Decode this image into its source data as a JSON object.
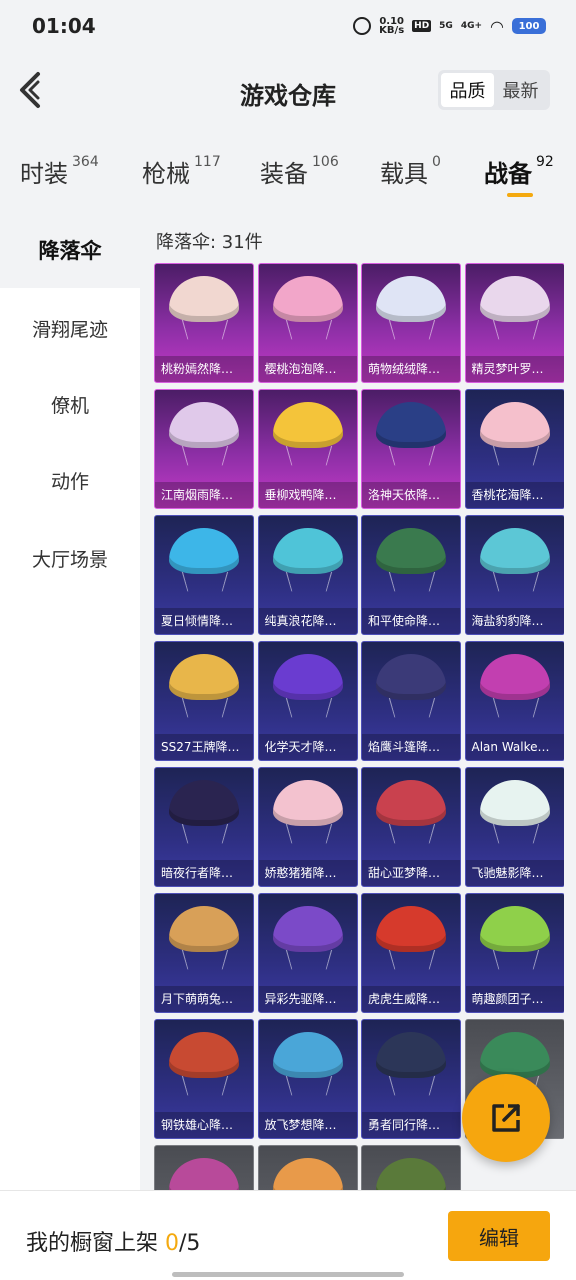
{
  "status_bar": {
    "time": "01:04",
    "speed_value": "0.10",
    "speed_unit": "KB/s",
    "hd1": "HD",
    "sig1": "5G",
    "sig2": "4G+",
    "battery": "100"
  },
  "header": {
    "title": "游戏仓库",
    "sort_options": [
      "品质",
      "最新"
    ],
    "sort_active": "品质"
  },
  "tabs": [
    {
      "label": "时装",
      "count": "364"
    },
    {
      "label": "枪械",
      "count": "117"
    },
    {
      "label": "装备",
      "count": "106"
    },
    {
      "label": "载具",
      "count": "0"
    },
    {
      "label": "战备",
      "count": "92"
    }
  ],
  "active_tab": "战备",
  "sidebar": {
    "items": [
      "降落伞",
      "滑翔尾迹",
      "僚机",
      "动作",
      "大厅场景"
    ],
    "active": "降落伞"
  },
  "grid": {
    "count_label": "降落伞: 31件",
    "items": [
      {
        "name": "桃粉嫣然降…",
        "rarity": "purple",
        "color": "#f1d7d0"
      },
      {
        "name": "樱桃泡泡降…",
        "rarity": "purple",
        "color": "#f2a6c9"
      },
      {
        "name": "萌物绒绒降…",
        "rarity": "purple",
        "color": "#dfe4f5"
      },
      {
        "name": "精灵梦叶罗…",
        "rarity": "purple",
        "color": "#e9d7ec"
      },
      {
        "name": "江南烟雨降…",
        "rarity": "purple",
        "color": "#e0c9ea"
      },
      {
        "name": "垂柳戏鸭降…",
        "rarity": "purple",
        "color": "#f4c43a"
      },
      {
        "name": "洛神天依降…",
        "rarity": "purple",
        "color": "#2a3f86"
      },
      {
        "name": "香桃花海降…",
        "rarity": "blue",
        "color": "#f5c0cc"
      },
      {
        "name": "夏日倾情降…",
        "rarity": "blue",
        "color": "#3db6e8"
      },
      {
        "name": "纯真浪花降…",
        "rarity": "blue",
        "color": "#4fc4d8"
      },
      {
        "name": "和平使命降…",
        "rarity": "blue",
        "color": "#3a7a4e"
      },
      {
        "name": "海盐豹豹降…",
        "rarity": "blue",
        "color": "#5cc7d6"
      },
      {
        "name": "SS27王牌降…",
        "rarity": "blue",
        "color": "#e8b64a"
      },
      {
        "name": "化学天才降…",
        "rarity": "blue",
        "color": "#6a3cd0"
      },
      {
        "name": "焰鹰斗篷降…",
        "rarity": "blue",
        "color": "#3b3a78"
      },
      {
        "name": "Alan Walke…",
        "rarity": "blue",
        "color": "#c23fb0"
      },
      {
        "name": "暗夜行者降…",
        "rarity": "blue",
        "color": "#2a2450"
      },
      {
        "name": "娇憨猪猪降…",
        "rarity": "blue",
        "color": "#f3c2cf"
      },
      {
        "name": "甜心亚梦降…",
        "rarity": "blue",
        "color": "#c9414e"
      },
      {
        "name": "飞驰魅影降…",
        "rarity": "blue",
        "color": "#e7f3f0"
      },
      {
        "name": "月下萌萌兔…",
        "rarity": "blue",
        "color": "#d8a058"
      },
      {
        "name": "异彩先驱降…",
        "rarity": "blue",
        "color": "#7b4ac8"
      },
      {
        "name": "虎虎生威降…",
        "rarity": "blue",
        "color": "#d63a2c"
      },
      {
        "name": "萌趣颜团子…",
        "rarity": "blue",
        "color": "#8fd04a"
      },
      {
        "name": "钢铁雄心降…",
        "rarity": "blue",
        "color": "#c84a32"
      },
      {
        "name": "放飞梦想降…",
        "rarity": "blue",
        "color": "#4aa6d8"
      },
      {
        "name": "勇者同行降…",
        "rarity": "blue",
        "color": "#2c3658"
      },
      {
        "name": "",
        "rarity": "grey",
        "color": "#3a8a5a"
      },
      {
        "name": "",
        "rarity": "grey",
        "color": "#b84a9a"
      },
      {
        "name": "",
        "rarity": "grey",
        "color": "#e89a4a"
      },
      {
        "name": "",
        "rarity": "grey",
        "color": "#5a7a3a"
      }
    ]
  },
  "bottom_bar": {
    "shelf_label": "我的橱窗上架",
    "shelf_current": "0",
    "shelf_total": "/5",
    "edit_label": "编辑"
  }
}
